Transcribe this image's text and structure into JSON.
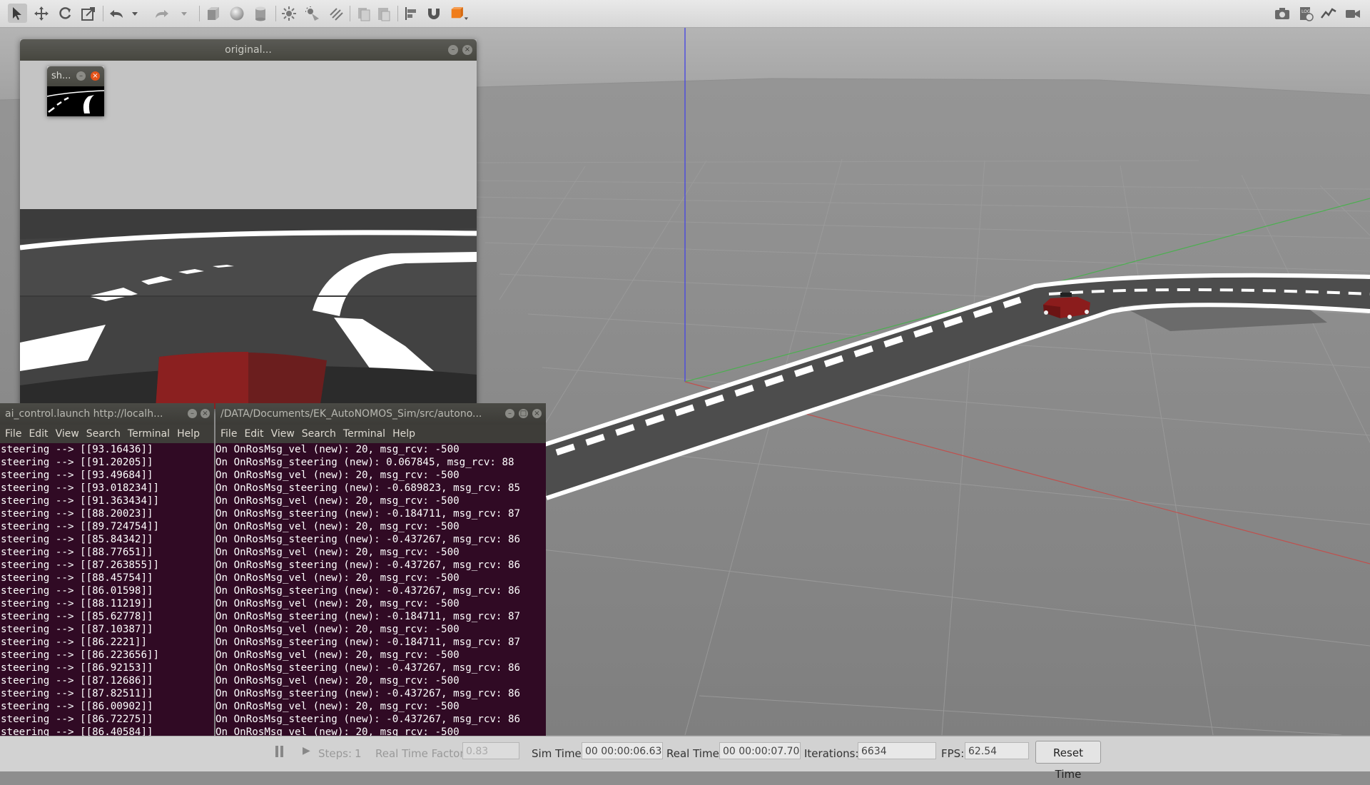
{
  "toolbar": {
    "icons": [
      "select-mode-icon",
      "translate-mode-icon",
      "rotate-mode-icon",
      "scale-mode-icon",
      "undo-icon",
      "undo-history-icon",
      "redo-icon",
      "redo-history-icon",
      "box-shape-icon",
      "sphere-shape-icon",
      "cylinder-shape-icon",
      "point-light-icon",
      "spot-light-icon",
      "directional-light-icon",
      "copy-icon",
      "paste-icon",
      "align-icon",
      "snap-icon",
      "change-view-icon"
    ],
    "right_icons": [
      "screenshot-icon",
      "log-icon",
      "plot-icon",
      "record-video-icon"
    ]
  },
  "camera_window": {
    "title": "original...",
    "mini_window_title": "sh..."
  },
  "terminal_left": {
    "title": "ai_control.launch http://localh...",
    "menu": [
      "File",
      "Edit",
      "View",
      "Search",
      "Terminal",
      "Help"
    ],
    "lines": [
      "steering --> [[93.16436]]",
      "steering --> [[91.20205]]",
      "steering --> [[93.49684]]",
      "steering --> [[93.018234]]",
      "steering --> [[91.363434]]",
      "steering --> [[88.20023]]",
      "steering --> [[89.724754]]",
      "steering --> [[85.84342]]",
      "steering --> [[88.77651]]",
      "steering --> [[87.263855]]",
      "steering --> [[88.45754]]",
      "steering --> [[86.01598]]",
      "steering --> [[88.11219]]",
      "steering --> [[85.62778]]",
      "steering --> [[87.10387]]",
      "steering --> [[86.2221]]",
      "steering --> [[86.223656]]",
      "steering --> [[86.92153]]",
      "steering --> [[87.12686]]",
      "steering --> [[87.82511]]",
      "steering --> [[86.00902]]",
      "steering --> [[86.72275]]",
      "steering --> [[86.40584]]"
    ]
  },
  "terminal_right": {
    "title": "/DATA/Documents/EK_AutoNOMOS_Sim/src/autono...",
    "menu": [
      "File",
      "Edit",
      "View",
      "Search",
      "Terminal",
      "Help"
    ],
    "lines": [
      "On OnRosMsg_vel (new): 20, msg_rcv: -500",
      "On OnRosMsg_steering (new): 0.067845, msg_rcv: 88",
      "On OnRosMsg_vel (new): 20, msg_rcv: -500",
      "On OnRosMsg_steering (new): -0.689823, msg_rcv: 85",
      "On OnRosMsg_vel (new): 20, msg_rcv: -500",
      "On OnRosMsg_steering (new): -0.184711, msg_rcv: 87",
      "On OnRosMsg_vel (new): 20, msg_rcv: -500",
      "On OnRosMsg_steering (new): -0.437267, msg_rcv: 86",
      "On OnRosMsg_vel (new): 20, msg_rcv: -500",
      "On OnRosMsg_steering (new): -0.437267, msg_rcv: 86",
      "On OnRosMsg_vel (new): 20, msg_rcv: -500",
      "On OnRosMsg_steering (new): -0.437267, msg_rcv: 86",
      "On OnRosMsg_vel (new): 20, msg_rcv: -500",
      "On OnRosMsg_steering (new): -0.184711, msg_rcv: 87",
      "On OnRosMsg_vel (new): 20, msg_rcv: -500",
      "On OnRosMsg_steering (new): -0.184711, msg_rcv: 87",
      "On OnRosMsg_vel (new): 20, msg_rcv: -500",
      "On OnRosMsg_steering (new): -0.437267, msg_rcv: 86",
      "On OnRosMsg_vel (new): 20, msg_rcv: -500",
      "On OnRosMsg_steering (new): -0.437267, msg_rcv: 86",
      "On OnRosMsg_vel (new): 20, msg_rcv: -500",
      "On OnRosMsg_steering (new): -0.437267, msg_rcv: 86",
      "On OnRosMsg_vel (new): 20, msg_rcv: -500"
    ]
  },
  "status_bar": {
    "steps_label": "Steps:",
    "steps_value": "1",
    "real_time_factor_label": "Real Time Factor:",
    "real_time_factor_value": "0.83",
    "sim_time_label": "Sim Time:",
    "sim_time_value": "00 00:00:06.634",
    "real_time_label": "Real Time:",
    "real_time_value": "00 00:00:07.700",
    "iterations_label": "Iterations:",
    "iterations_value": "6634",
    "fps_label": "FPS:",
    "fps_value": "62.54",
    "reset_time_label": "Reset Time"
  },
  "colors": {
    "terminal_bg": "#300a24",
    "car": "#8b1c1c",
    "x_axis": "#c0504d",
    "y_axis": "#4caf50",
    "z_axis": "#4a4ae0"
  }
}
